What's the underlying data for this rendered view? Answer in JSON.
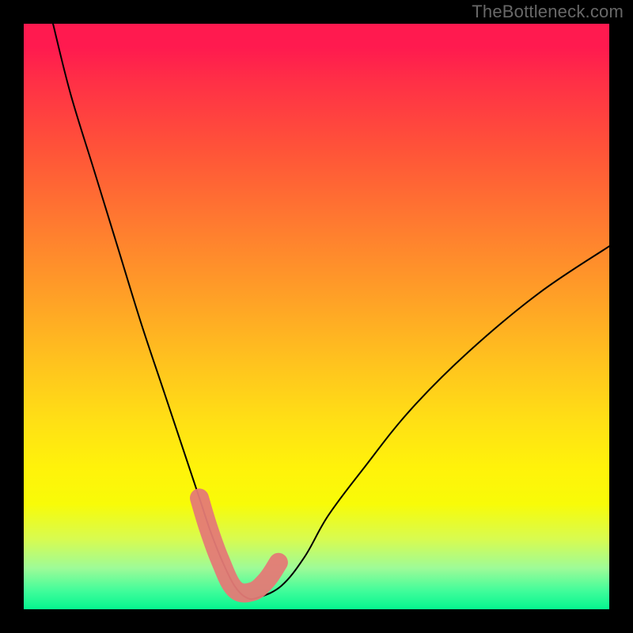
{
  "watermark": "TheBottleneck.com",
  "chart_data": {
    "type": "line",
    "title": "",
    "xlabel": "",
    "ylabel": "",
    "xlim": [
      0,
      100
    ],
    "ylim": [
      0,
      100
    ],
    "colors": {
      "curve": "#000000",
      "marker_fill": "#e47a76",
      "marker_stroke": "#d45a56",
      "gradient_top": "#ff1a4f",
      "gradient_bottom": "#05f58f"
    },
    "series": [
      {
        "name": "bottleneck-curve",
        "x": [
          5,
          8,
          12,
          16,
          20,
          24,
          28,
          30,
          32,
          34,
          36,
          38,
          40,
          44,
          48,
          52,
          58,
          66,
          76,
          88,
          100
        ],
        "y": [
          100,
          88,
          75,
          62,
          49,
          37,
          25,
          19,
          13,
          8,
          4,
          2,
          2,
          4,
          9,
          16,
          24,
          34,
          44,
          54,
          62
        ]
      }
    ],
    "markers": {
      "name": "highlight-points",
      "x": [
        30,
        31.5,
        33.5,
        36,
        39,
        41.5,
        43.5
      ],
      "y": [
        19,
        14,
        8.5,
        3.5,
        3,
        5,
        8
      ]
    }
  }
}
